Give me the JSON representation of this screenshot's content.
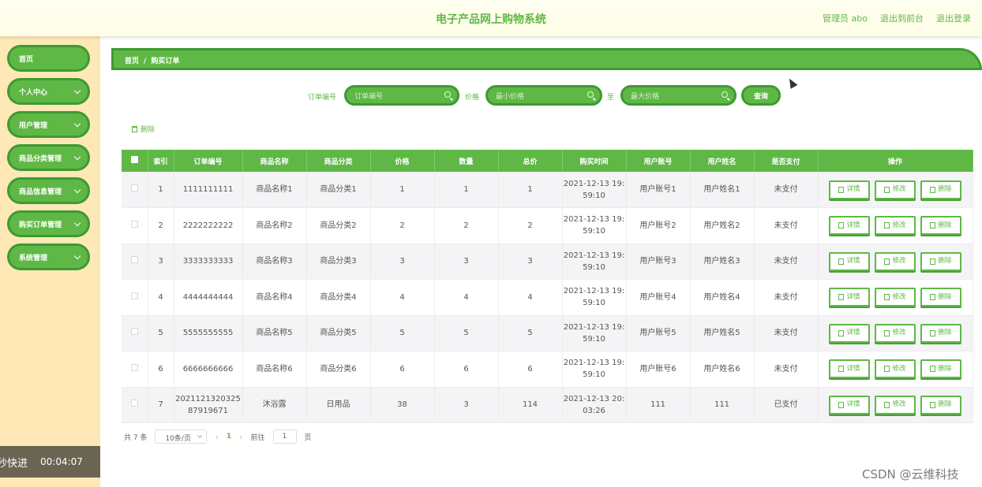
{
  "header": {
    "title": "电子产品网上购物系统",
    "admin": "管理员 abo",
    "front": "退出到前台",
    "logout": "退出登录"
  },
  "sidebar": {
    "items": [
      {
        "label": "首页",
        "chevron": false
      },
      {
        "label": "个人中心",
        "chevron": true
      },
      {
        "label": "用户管理",
        "chevron": true
      },
      {
        "label": "商品分类管理",
        "chevron": true
      },
      {
        "label": "商品信息管理",
        "chevron": true
      },
      {
        "label": "购买订单管理",
        "chevron": true
      },
      {
        "label": "系统管理",
        "chevron": true
      }
    ]
  },
  "timer": {
    "label": "秒快进",
    "time": "00:04:07"
  },
  "breadcrumb": {
    "home": "首页",
    "sep": "/",
    "current": "购买订单"
  },
  "search": {
    "order_label": "订单编号",
    "order_placeholder": "订单编号",
    "price_label": "价格",
    "min_placeholder": "最小价格",
    "to_label": "至",
    "max_placeholder": "最大价格",
    "query_label": "查询"
  },
  "batch_delete_label": "删除",
  "table": {
    "headers": [
      "",
      "索引",
      "订单编号",
      "商品名称",
      "商品分类",
      "价格",
      "数量",
      "总价",
      "购买时间",
      "用户账号",
      "用户姓名",
      "是否支付",
      "操作"
    ],
    "rows": [
      {
        "idx": "1",
        "order": "1111111111",
        "name": "商品名称1",
        "cat": "商品分类1",
        "price": "1",
        "qty": "1",
        "total": "1",
        "time": "2021-12-13 19:59:10",
        "account": "用户账号1",
        "uname": "用户姓名1",
        "paid": "未支付"
      },
      {
        "idx": "2",
        "order": "2222222222",
        "name": "商品名称2",
        "cat": "商品分类2",
        "price": "2",
        "qty": "2",
        "total": "2",
        "time": "2021-12-13 19:59:10",
        "account": "用户账号2",
        "uname": "用户姓名2",
        "paid": "未支付"
      },
      {
        "idx": "3",
        "order": "3333333333",
        "name": "商品名称3",
        "cat": "商品分类3",
        "price": "3",
        "qty": "3",
        "total": "3",
        "time": "2021-12-13 19:59:10",
        "account": "用户账号3",
        "uname": "用户姓名3",
        "paid": "未支付"
      },
      {
        "idx": "4",
        "order": "4444444444",
        "name": "商品名称4",
        "cat": "商品分类4",
        "price": "4",
        "qty": "4",
        "total": "4",
        "time": "2021-12-13 19:59:10",
        "account": "用户账号4",
        "uname": "用户姓名4",
        "paid": "未支付"
      },
      {
        "idx": "5",
        "order": "5555555555",
        "name": "商品名称5",
        "cat": "商品分类5",
        "price": "5",
        "qty": "5",
        "total": "5",
        "time": "2021-12-13 19:59:10",
        "account": "用户账号5",
        "uname": "用户姓名5",
        "paid": "未支付"
      },
      {
        "idx": "6",
        "order": "6666666666",
        "name": "商品名称6",
        "cat": "商品分类6",
        "price": "6",
        "qty": "6",
        "total": "6",
        "time": "2021-12-13 19:59:10",
        "account": "用户账号6",
        "uname": "用户姓名6",
        "paid": "未支付"
      },
      {
        "idx": "7",
        "order": "202112132032587919671",
        "name": "沐浴露",
        "cat": "日用品",
        "price": "38",
        "qty": "3",
        "total": "114",
        "time": "2021-12-13 20:03:26",
        "account": "111",
        "uname": "111",
        "paid": "已支付"
      }
    ],
    "actions": {
      "detail": "详情",
      "edit": "修改",
      "delete": "删除"
    }
  },
  "pager": {
    "total": "共 7 条",
    "size": "10条/页",
    "prev": "‹",
    "current": "1",
    "next": "›",
    "goto": "前往",
    "goto_value": "1",
    "page_unit": "页"
  },
  "watermark": "CSDN @云维科技",
  "colors": {
    "primary": "#5fb846",
    "border": "#3e9a32",
    "sidebar_bg": "#fde8b6"
  }
}
